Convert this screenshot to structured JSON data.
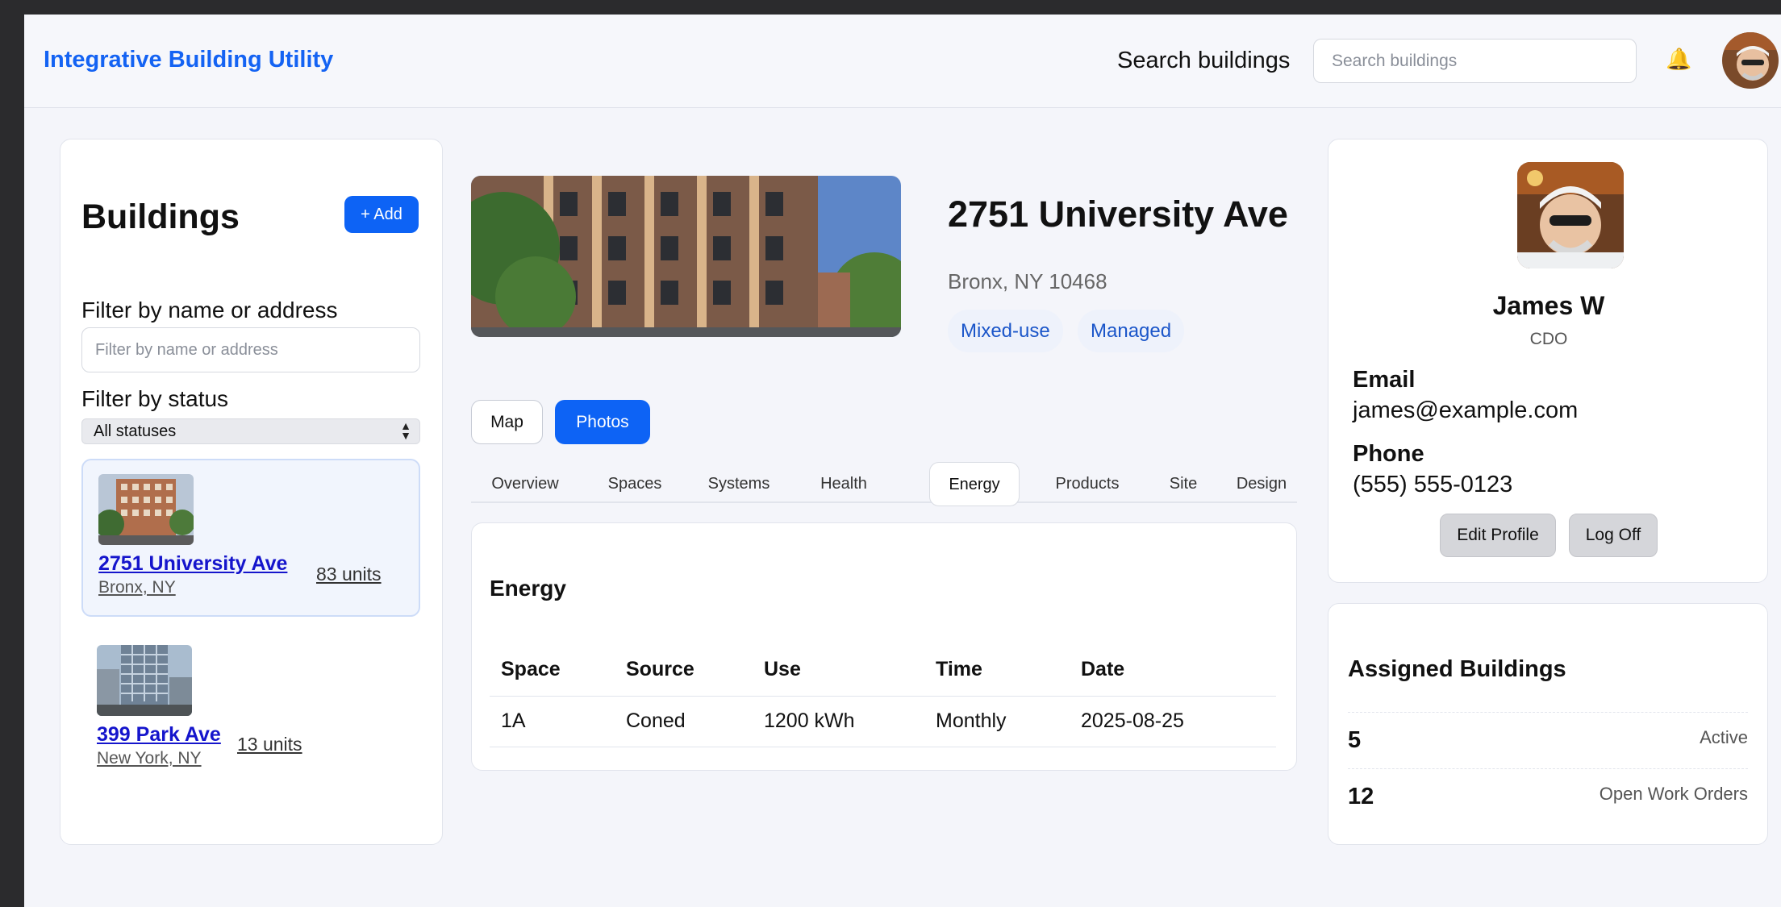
{
  "header": {
    "brand": "Integrative Building Utility",
    "search_label": "Search buildings",
    "search_placeholder": "Search buildings",
    "bell_icon": "🔔"
  },
  "sidebar": {
    "title": "Buildings",
    "add_label": "+ Add",
    "filter_label": "Filter by name or address",
    "filter_placeholder": "Filter by name or address",
    "status_label": "Filter by status",
    "status_value": "All statuses",
    "buildings": [
      {
        "name": "2751 University Ave",
        "city": "Bronx, NY",
        "units": "83 units"
      },
      {
        "name": "399 Park Ave",
        "city": "New York, NY",
        "units": "13 units"
      }
    ]
  },
  "main": {
    "title": "2751 University Ave",
    "address": "Bronx, NY 10468",
    "tags": [
      "Mixed-use",
      "Managed"
    ],
    "views": [
      "Map",
      "Photos"
    ],
    "tabs": [
      "Overview",
      "Spaces",
      "Systems",
      "Health",
      "Energy",
      "Products",
      "Site",
      "Design"
    ],
    "active_tab": "Energy",
    "energy": {
      "title": "Energy",
      "columns": [
        "Space",
        "Source",
        "Use",
        "Time",
        "Date"
      ],
      "rows": [
        [
          "1A",
          "Coned",
          "1200 kWh",
          "Monthly",
          "2025-08-25"
        ]
      ]
    }
  },
  "profile": {
    "name": "James W",
    "role": "CDO",
    "email_label": "Email",
    "email": "james@example.com",
    "phone_label": "Phone",
    "phone": "(555) 555-0123",
    "edit_label": "Edit Profile",
    "logoff_label": "Log Off"
  },
  "assigned": {
    "title": "Assigned Buildings",
    "stats": [
      {
        "value": "5",
        "label": "Active"
      },
      {
        "value": "12",
        "label": "Open Work Orders"
      }
    ]
  },
  "colors": {
    "accent": "#0d63f5",
    "brand": "#1463f3",
    "link": "#1515cc"
  }
}
